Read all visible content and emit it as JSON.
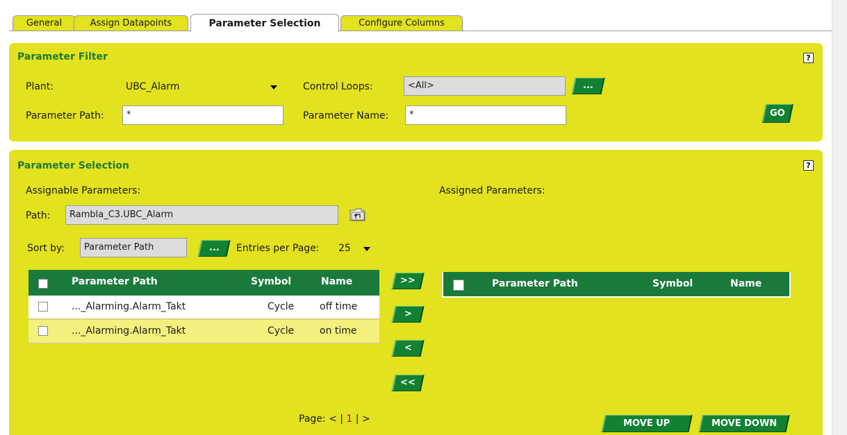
{
  "tabs": [
    {
      "label": "General"
    },
    {
      "label": "Assign Datapoints"
    },
    {
      "label": "Parameter Selection"
    },
    {
      "label": "Configure Columns"
    }
  ],
  "filter": {
    "title": "Parameter Filter",
    "help": "?",
    "plant_label": "Plant:",
    "plant_value": "UBC_Alarm",
    "control_loops_label": "Control Loops:",
    "control_loops_value": "<All>",
    "browse_button": "...",
    "parameter_path_label": "Parameter Path:",
    "parameter_path_value": "*",
    "parameter_name_label": "Parameter Name:",
    "parameter_name_value": "*",
    "go_button": "GO"
  },
  "selection": {
    "title": "Parameter Selection",
    "help": "?",
    "assignable_label": "Assignable Parameters:",
    "assigned_label": "Assigned Parameters:",
    "path_label": "Path:",
    "path_value": "Rambla_C3.UBC_Alarm",
    "sort_label": "Sort by:",
    "sort_value": "Parameter Path",
    "sort_button": "...",
    "entries_label": "Entries per Page:",
    "entries_value": "25",
    "left_table": {
      "columns": [
        "Parameter Path",
        "Symbol",
        "Name"
      ],
      "rows": [
        {
          "path": "..._Alarming.Alarm_Takt",
          "symbol": "Cycle",
          "name": "off time"
        },
        {
          "path": "..._Alarming.Alarm_Takt",
          "symbol": "Cycle",
          "name": "on time"
        }
      ]
    },
    "right_table": {
      "columns": [
        "Parameter Path",
        "Symbol",
        "Name"
      ]
    },
    "buttons": {
      "add_all": ">>",
      "add": ">",
      "remove": "<",
      "remove_all": "<<",
      "move_up": "MOVE UP",
      "move_down": "MOVE DOWN"
    },
    "pager": {
      "label": "Page:",
      "prev": "<",
      "sep1": "|",
      "current": "1",
      "sep2": "|",
      "next": ">"
    }
  }
}
